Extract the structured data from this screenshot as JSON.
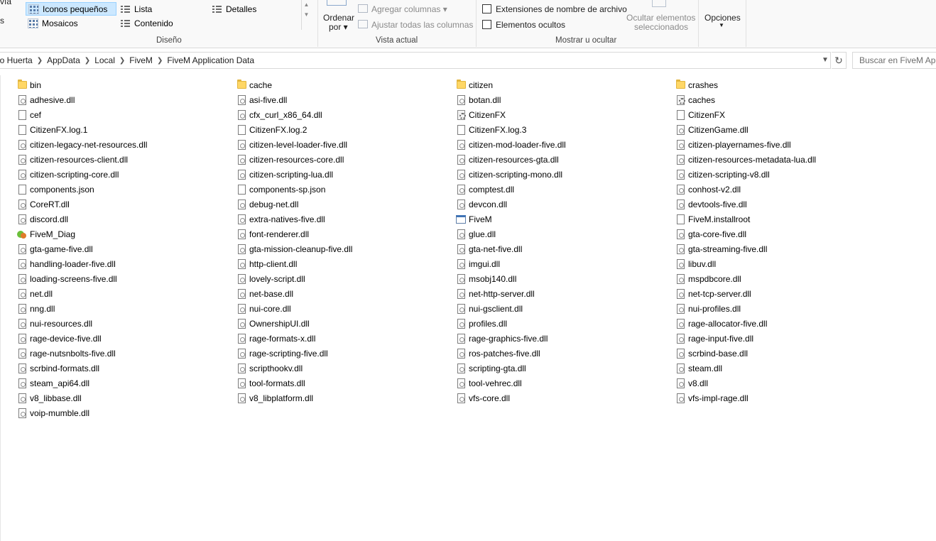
{
  "ribbon": {
    "partial_left_text": "vía",
    "partial_left_text2": "s",
    "layout": {
      "items": [
        {
          "label": "Iconos pequeños",
          "selected": true
        },
        {
          "label": "Lista",
          "selected": false
        },
        {
          "label": "Detalles",
          "selected": false
        },
        {
          "label": "Mosaicos",
          "selected": false
        },
        {
          "label": "Contenido",
          "selected": false
        }
      ],
      "group_label": "Diseño"
    },
    "current_view": {
      "sort_label_1": "Ordenar",
      "sort_label_2": "por",
      "add_columns": "Agregar columnas",
      "fit_columns": "Ajustar todas las columnas",
      "group_label": "Vista actual"
    },
    "show_hide": {
      "file_extensions": "Extensiones de nombre de archivo",
      "hidden_items": "Elementos ocultos",
      "hide_selected_1": "Ocultar elementos",
      "hide_selected_2": "seleccionados",
      "group_label": "Mostrar u ocultar"
    },
    "options": {
      "label": "Opciones"
    }
  },
  "address": {
    "crumbs": [
      "do Huerta",
      "AppData",
      "Local",
      "FiveM",
      "FiveM Application Data"
    ],
    "search_placeholder": "Buscar en FiveM Application Data"
  },
  "files": {
    "col1": [
      {
        "name": "bin",
        "icon": "folder-icon"
      },
      {
        "name": "adhesive.dll",
        "icon": "dll-file-icon"
      },
      {
        "name": "cef",
        "icon": "file-icon"
      },
      {
        "name": "CitizenFX.log.1",
        "icon": "file-icon"
      },
      {
        "name": "citizen-legacy-net-resources.dll",
        "icon": "dll-file-icon"
      },
      {
        "name": "citizen-resources-client.dll",
        "icon": "dll-file-icon"
      },
      {
        "name": "citizen-scripting-core.dll",
        "icon": "dll-file-icon"
      },
      {
        "name": "components.json",
        "icon": "file-icon"
      },
      {
        "name": "CoreRT.dll",
        "icon": "dll-file-icon"
      },
      {
        "name": "discord.dll",
        "icon": "dll-file-icon"
      },
      {
        "name": "FiveM_Diag",
        "icon": "diag-app-icon"
      },
      {
        "name": "gta-game-five.dll",
        "icon": "dll-file-icon"
      },
      {
        "name": "handling-loader-five.dll",
        "icon": "dll-file-icon"
      },
      {
        "name": "loading-screens-five.dll",
        "icon": "dll-file-icon"
      },
      {
        "name": "net.dll",
        "icon": "dll-file-icon"
      },
      {
        "name": "nng.dll",
        "icon": "dll-file-icon"
      },
      {
        "name": "nui-resources.dll",
        "icon": "dll-file-icon"
      },
      {
        "name": "rage-device-five.dll",
        "icon": "dll-file-icon"
      },
      {
        "name": "rage-nutsnbolts-five.dll",
        "icon": "dll-file-icon"
      },
      {
        "name": "scrbind-formats.dll",
        "icon": "dll-file-icon"
      },
      {
        "name": "steam_api64.dll",
        "icon": "dll-file-icon"
      },
      {
        "name": "v8_libbase.dll",
        "icon": "dll-file-icon"
      },
      {
        "name": "voip-mumble.dll",
        "icon": "dll-file-icon"
      }
    ],
    "col2": [
      {
        "name": "cache",
        "icon": "folder-icon"
      },
      {
        "name": "asi-five.dll",
        "icon": "dll-file-icon"
      },
      {
        "name": "cfx_curl_x86_64.dll",
        "icon": "dll-file-icon"
      },
      {
        "name": "CitizenFX.log.2",
        "icon": "file-icon"
      },
      {
        "name": "citizen-level-loader-five.dll",
        "icon": "dll-file-icon"
      },
      {
        "name": "citizen-resources-core.dll",
        "icon": "dll-file-icon"
      },
      {
        "name": "citizen-scripting-lua.dll",
        "icon": "dll-file-icon"
      },
      {
        "name": "components-sp.json",
        "icon": "file-icon"
      },
      {
        "name": "debug-net.dll",
        "icon": "dll-file-icon"
      },
      {
        "name": "extra-natives-five.dll",
        "icon": "dll-file-icon"
      },
      {
        "name": "font-renderer.dll",
        "icon": "dll-file-icon"
      },
      {
        "name": "gta-mission-cleanup-five.dll",
        "icon": "dll-file-icon"
      },
      {
        "name": "http-client.dll",
        "icon": "dll-file-icon"
      },
      {
        "name": "lovely-script.dll",
        "icon": "dll-file-icon"
      },
      {
        "name": "net-base.dll",
        "icon": "dll-file-icon"
      },
      {
        "name": "nui-core.dll",
        "icon": "dll-file-icon"
      },
      {
        "name": "OwnershipUI.dll",
        "icon": "dll-file-icon"
      },
      {
        "name": "rage-formats-x.dll",
        "icon": "dll-file-icon"
      },
      {
        "name": "rage-scripting-five.dll",
        "icon": "dll-file-icon"
      },
      {
        "name": "scripthookv.dll",
        "icon": "dll-file-icon"
      },
      {
        "name": "tool-formats.dll",
        "icon": "dll-file-icon"
      },
      {
        "name": "v8_libplatform.dll",
        "icon": "dll-file-icon"
      }
    ],
    "col3": [
      {
        "name": "citizen",
        "icon": "folder-icon"
      },
      {
        "name": "botan.dll",
        "icon": "dll-file-icon"
      },
      {
        "name": "CitizenFX",
        "icon": "config-file-icon"
      },
      {
        "name": "CitizenFX.log.3",
        "icon": "file-icon"
      },
      {
        "name": "citizen-mod-loader-five.dll",
        "icon": "dll-file-icon"
      },
      {
        "name": "citizen-resources-gta.dll",
        "icon": "dll-file-icon"
      },
      {
        "name": "citizen-scripting-mono.dll",
        "icon": "dll-file-icon"
      },
      {
        "name": "comptest.dll",
        "icon": "dll-file-icon"
      },
      {
        "name": "devcon.dll",
        "icon": "dll-file-icon"
      },
      {
        "name": "FiveM",
        "icon": "app-icon"
      },
      {
        "name": "glue.dll",
        "icon": "dll-file-icon"
      },
      {
        "name": "gta-net-five.dll",
        "icon": "dll-file-icon"
      },
      {
        "name": "imgui.dll",
        "icon": "dll-file-icon"
      },
      {
        "name": "msobj140.dll",
        "icon": "dll-file-icon"
      },
      {
        "name": "net-http-server.dll",
        "icon": "dll-file-icon"
      },
      {
        "name": "nui-gsclient.dll",
        "icon": "dll-file-icon"
      },
      {
        "name": "profiles.dll",
        "icon": "dll-file-icon"
      },
      {
        "name": "rage-graphics-five.dll",
        "icon": "dll-file-icon"
      },
      {
        "name": "ros-patches-five.dll",
        "icon": "dll-file-icon"
      },
      {
        "name": "scripting-gta.dll",
        "icon": "dll-file-icon"
      },
      {
        "name": "tool-vehrec.dll",
        "icon": "dll-file-icon"
      },
      {
        "name": "vfs-core.dll",
        "icon": "dll-file-icon"
      }
    ],
    "col4": [
      {
        "name": "crashes",
        "icon": "folder-icon"
      },
      {
        "name": "caches",
        "icon": "config-file-icon"
      },
      {
        "name": "CitizenFX",
        "icon": "file-icon"
      },
      {
        "name": "CitizenGame.dll",
        "icon": "dll-file-icon"
      },
      {
        "name": "citizen-playernames-five.dll",
        "icon": "dll-file-icon"
      },
      {
        "name": "citizen-resources-metadata-lua.dll",
        "icon": "dll-file-icon"
      },
      {
        "name": "citizen-scripting-v8.dll",
        "icon": "dll-file-icon"
      },
      {
        "name": "conhost-v2.dll",
        "icon": "dll-file-icon"
      },
      {
        "name": "devtools-five.dll",
        "icon": "dll-file-icon"
      },
      {
        "name": "FiveM.installroot",
        "icon": "file-icon"
      },
      {
        "name": "gta-core-five.dll",
        "icon": "dll-file-icon"
      },
      {
        "name": "gta-streaming-five.dll",
        "icon": "dll-file-icon"
      },
      {
        "name": "libuv.dll",
        "icon": "dll-file-icon"
      },
      {
        "name": "mspdbcore.dll",
        "icon": "dll-file-icon"
      },
      {
        "name": "net-tcp-server.dll",
        "icon": "dll-file-icon"
      },
      {
        "name": "nui-profiles.dll",
        "icon": "dll-file-icon"
      },
      {
        "name": "rage-allocator-five.dll",
        "icon": "dll-file-icon"
      },
      {
        "name": "rage-input-five.dll",
        "icon": "dll-file-icon"
      },
      {
        "name": "scrbind-base.dll",
        "icon": "dll-file-icon"
      },
      {
        "name": "steam.dll",
        "icon": "dll-file-icon"
      },
      {
        "name": "v8.dll",
        "icon": "dll-file-icon"
      },
      {
        "name": "vfs-impl-rage.dll",
        "icon": "dll-file-icon"
      }
    ]
  }
}
